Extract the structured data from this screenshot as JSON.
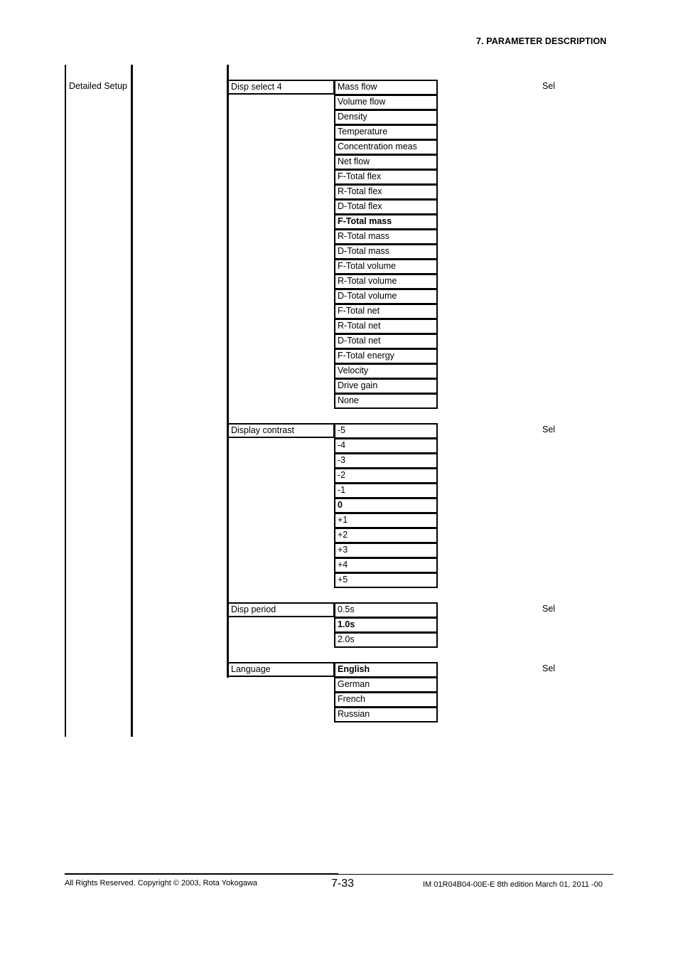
{
  "header": {
    "title": "7.  PARAMETER DESCRIPTION"
  },
  "section": {
    "label": "Detailed Setup"
  },
  "groups": [
    {
      "param": "Disp select 4",
      "access": "Sel",
      "options": [
        {
          "label": "Mass flow",
          "default": false
        },
        {
          "label": "Volume flow",
          "default": false
        },
        {
          "label": "Density",
          "default": false
        },
        {
          "label": "Temperature",
          "default": false
        },
        {
          "label": "Concentration meas",
          "default": false
        },
        {
          "label": "Net flow",
          "default": false
        },
        {
          "label": "F-Total flex",
          "default": false
        },
        {
          "label": "R-Total flex",
          "default": false
        },
        {
          "label": "D-Total flex",
          "default": false
        },
        {
          "label": "F-Total mass",
          "default": true
        },
        {
          "label": "R-Total mass",
          "default": false
        },
        {
          "label": "D-Total mass",
          "default": false
        },
        {
          "label": "F-Total volume",
          "default": false
        },
        {
          "label": "R-Total volume",
          "default": false
        },
        {
          "label": "D-Total volume",
          "default": false
        },
        {
          "label": "F-Total net",
          "default": false
        },
        {
          "label": "R-Total net",
          "default": false
        },
        {
          "label": "D-Total net",
          "default": false
        },
        {
          "label": "F-Total energy",
          "default": false
        },
        {
          "label": "Velocity",
          "default": false
        },
        {
          "label": "Drive gain",
          "default": false
        },
        {
          "label": "None",
          "default": false
        }
      ]
    },
    {
      "param": "Display contrast",
      "access": "Sel",
      "options": [
        {
          "label": "-5",
          "default": false
        },
        {
          "label": "-4",
          "default": false
        },
        {
          "label": "-3",
          "default": false
        },
        {
          "label": "-2",
          "default": false
        },
        {
          "label": "-1",
          "default": false
        },
        {
          "label": "0",
          "default": true
        },
        {
          "label": "+1",
          "default": false
        },
        {
          "label": "+2",
          "default": false
        },
        {
          "label": "+3",
          "default": false
        },
        {
          "label": "+4",
          "default": false
        },
        {
          "label": "+5",
          "default": false
        }
      ]
    },
    {
      "param": "Disp period",
      "access": "Sel",
      "options": [
        {
          "label": "0.5s",
          "default": false
        },
        {
          "label": "1.0s",
          "default": true
        },
        {
          "label": "2.0s",
          "default": false
        }
      ]
    },
    {
      "param": "Language",
      "access": "Sel",
      "options": [
        {
          "label": "English",
          "default": true
        },
        {
          "label": "German",
          "default": false
        },
        {
          "label": "French",
          "default": false
        },
        {
          "label": "Russian",
          "default": false
        }
      ]
    }
  ],
  "footer": {
    "copyright": "All Rights Reserved. Copyright © 2003, Rota Yokogawa",
    "page_number": "7-33",
    "doc_id": "IM 01R04B04-00E-E  8th edition March 01, 2011 -00"
  }
}
